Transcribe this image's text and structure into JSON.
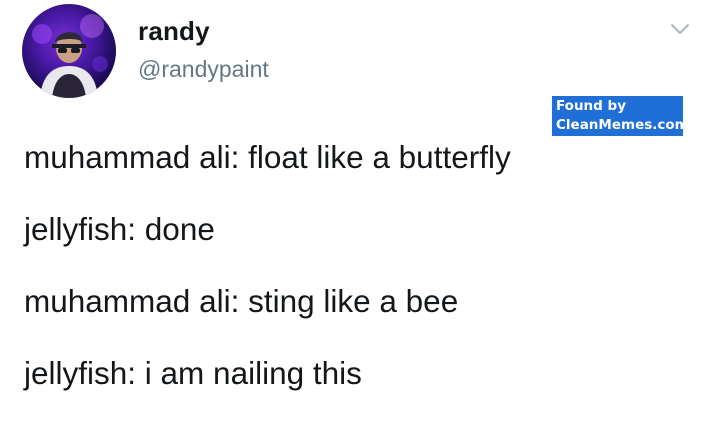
{
  "author": {
    "display_name": "randy",
    "handle": "@randypaint",
    "avatar_icon": "profile-photo-avatar"
  },
  "menu": {
    "icon": "chevron-down-icon",
    "color": "#aab8c2"
  },
  "watermark": {
    "line1": "Found by",
    "line2": "CleanMemes.com",
    "background": "#1f6fd6"
  },
  "tweet": {
    "lines": [
      "muhammad ali: float like a butterfly",
      "jellyfish: done",
      "muhammad ali: sting like a bee",
      "jellyfish: i am nailing this"
    ]
  },
  "colors": {
    "text": "#14171a",
    "handle": "#657786"
  }
}
